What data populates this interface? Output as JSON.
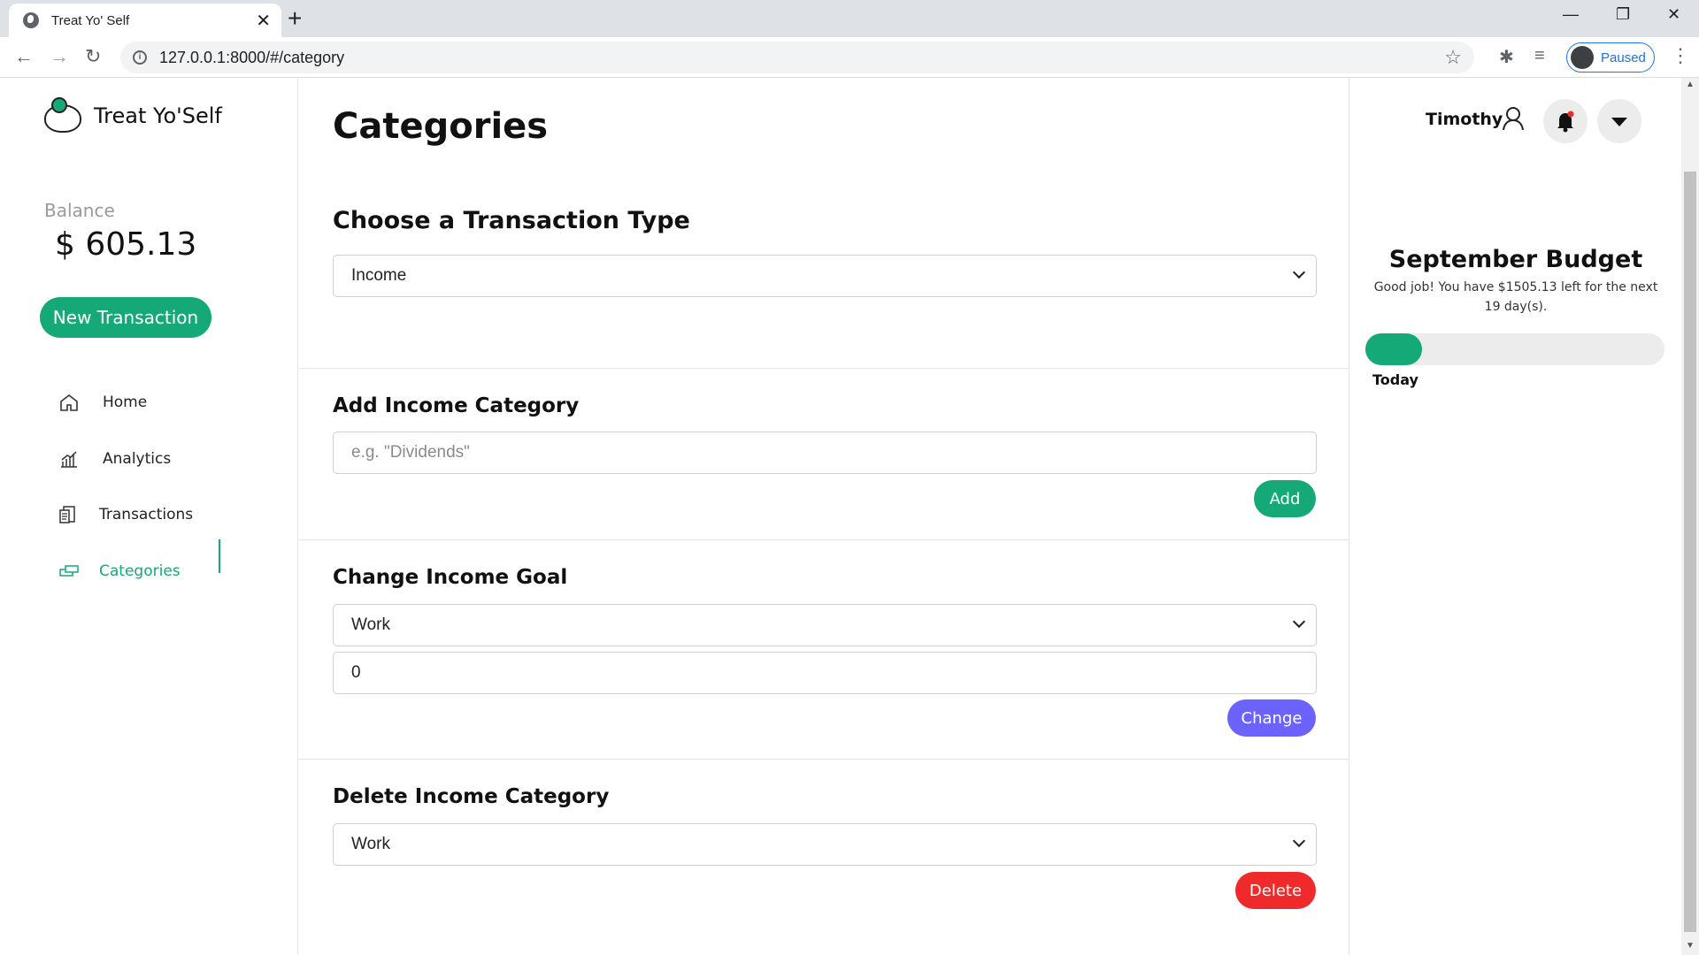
{
  "browser": {
    "tab_title": "Treat Yo' Self",
    "tab_close": "✕",
    "new_tab": "+",
    "url": "127.0.0.1:8000/#/category",
    "profile_status": "Paused",
    "minimize": "—",
    "restore": "❐",
    "close": "✕"
  },
  "sidebar": {
    "app_name": "Treat Yo'Self",
    "balance_label": "Balance",
    "balance_value": "$ 605.13",
    "new_transaction_label": "New Transaction",
    "nav": [
      {
        "label": "Home",
        "icon": "home-icon"
      },
      {
        "label": "Analytics",
        "icon": "analytics-icon"
      },
      {
        "label": "Transactions",
        "icon": "transactions-icon"
      },
      {
        "label": "Categories",
        "icon": "categories-icon",
        "active": true
      }
    ]
  },
  "main": {
    "title": "Categories",
    "choose_type": {
      "heading": "Choose a Transaction Type",
      "selected": "Income"
    },
    "add_category": {
      "heading": "Add Income Category",
      "placeholder": "e.g. \"Dividends\"",
      "button": "Add"
    },
    "change_goal": {
      "heading": "Change Income Goal",
      "selected": "Work",
      "value": "0",
      "button": "Change"
    },
    "delete_category": {
      "heading": "Delete Income Category",
      "selected": "Work",
      "button": "Delete"
    }
  },
  "right": {
    "user_name": "Timothy",
    "budget_title": "September Budget",
    "budget_message": "Good job! You have $1505.13 left for the next 19 day(s).",
    "progress_fraction": 0.19,
    "progress_label": "Today"
  },
  "colors": {
    "accent_green": "#15a978",
    "change_purple": "#6c63ff",
    "delete_red": "#f02a2a"
  }
}
